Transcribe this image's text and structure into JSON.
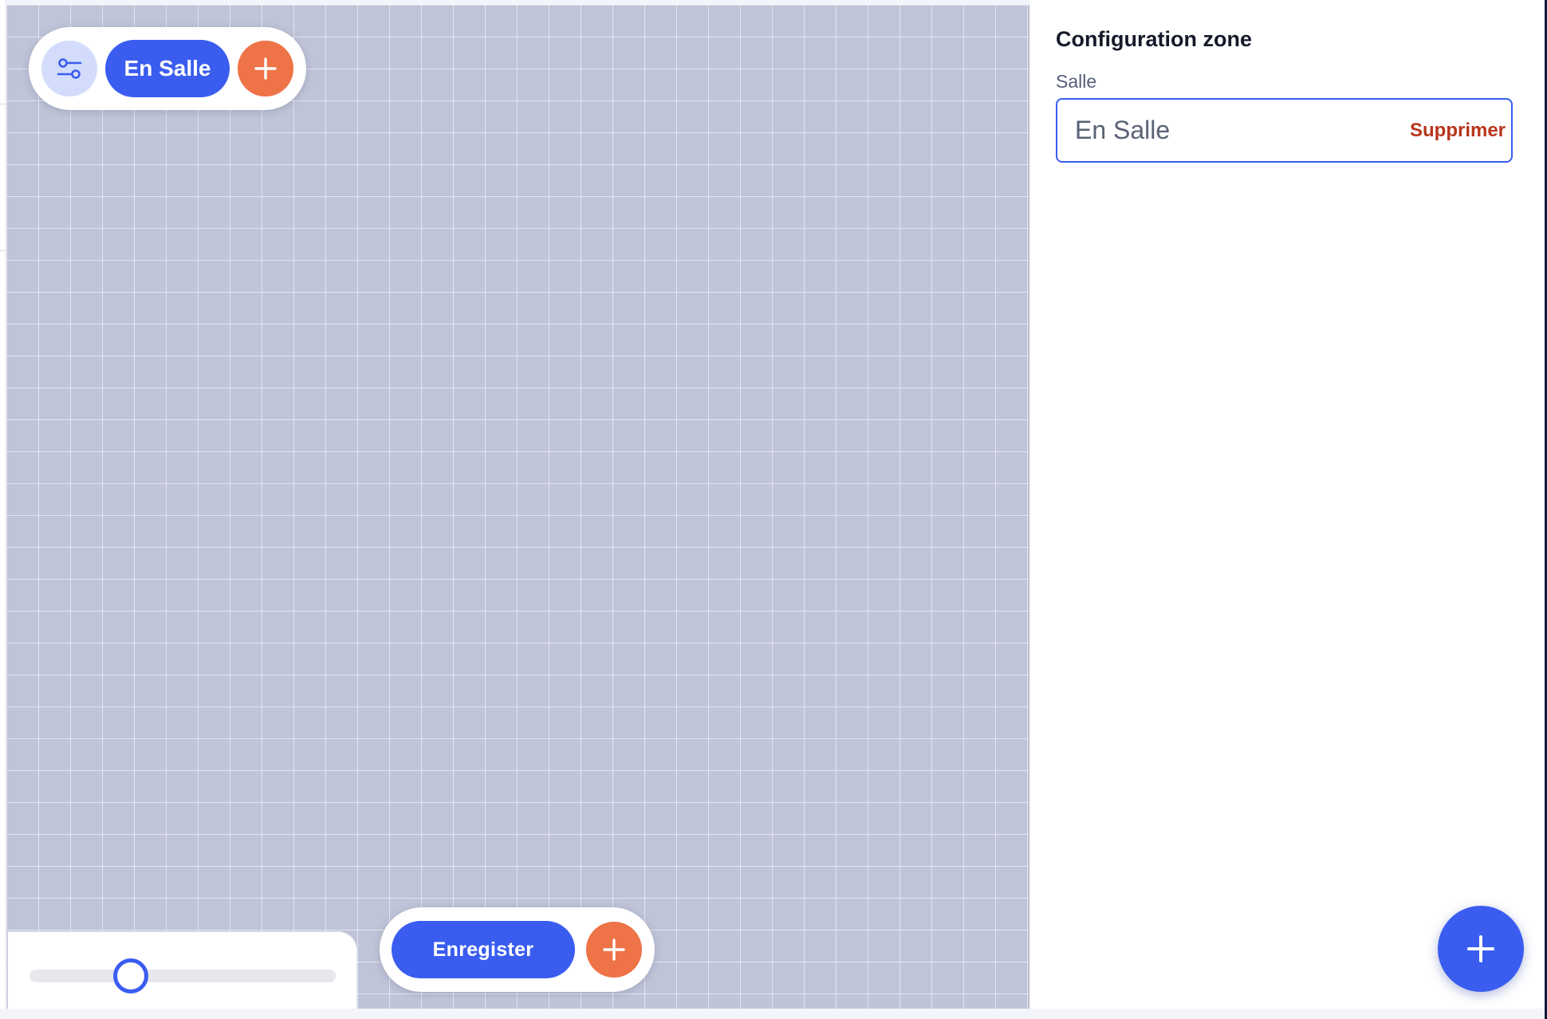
{
  "toolbar": {
    "settings_icon": "sliders-icon",
    "zone_label": "En Salle",
    "add_icon": "plus-icon"
  },
  "zoom": {
    "value": 0.33
  },
  "footer": {
    "save_label": "Enregister",
    "add_icon": "plus-icon"
  },
  "panel": {
    "title": "Configuration zone",
    "field_label": "Salle",
    "zone_name_value": "En Salle",
    "delete_label": "Supprimer"
  },
  "fab": {
    "icon": "plus-icon"
  },
  "colors": {
    "primary": "#3a5df0",
    "accent": "#ee7347",
    "danger": "#b8351c",
    "canvas": "#c0c4d8"
  }
}
